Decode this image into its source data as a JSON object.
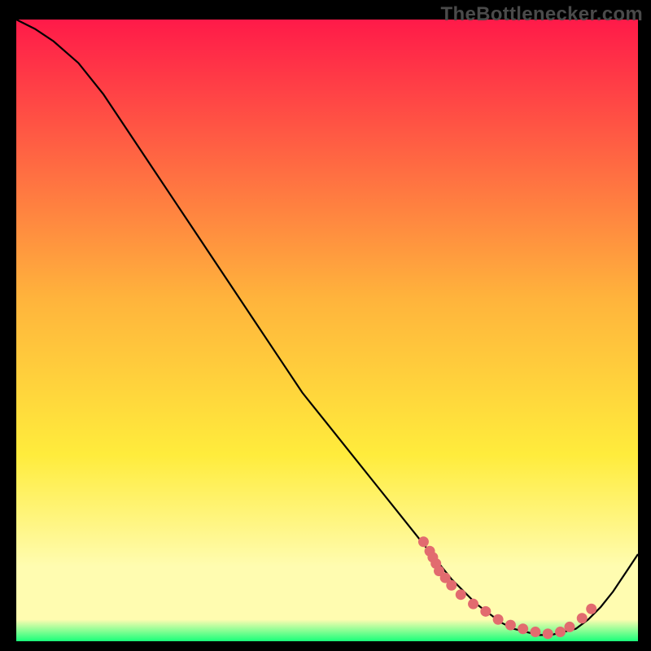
{
  "watermark": "TheBottlenecker.com",
  "colors": {
    "gradient_top": "#ff1a49",
    "gradient_mid_orange": "#ffb43c",
    "gradient_mid_yellow": "#ffec3c",
    "gradient_pale_yellow": "#fffcb0",
    "gradient_green": "#19ff7a",
    "frame": "#000000",
    "curve": "#000000",
    "dot": "#e26b6f"
  },
  "chart_data": {
    "type": "line",
    "title": "",
    "xlabel": "",
    "ylabel": "",
    "xlim": [
      0,
      100
    ],
    "ylim": [
      0,
      100
    ],
    "curve": {
      "x": [
        0,
        3,
        6,
        10,
        14,
        18,
        22,
        26,
        30,
        34,
        38,
        42,
        46,
        50,
        54,
        58,
        62,
        66,
        68,
        70,
        72,
        74,
        76,
        78,
        80,
        82,
        84,
        86,
        88,
        90,
        92,
        94,
        96,
        98,
        100
      ],
      "y": [
        100,
        98.5,
        96.5,
        93,
        88,
        82,
        76,
        70,
        64,
        58,
        52,
        46,
        40,
        35,
        30,
        25,
        20,
        15,
        12.5,
        10,
        8,
        6,
        4.5,
        3,
        2,
        1.5,
        1,
        1,
        1.5,
        2,
        3.5,
        5.5,
        8,
        11,
        14
      ]
    },
    "dots": {
      "x": [
        65.5,
        66.5,
        67,
        67.5,
        68,
        69,
        70,
        71.5,
        73.5,
        75.5,
        77.5,
        79.5,
        81.5,
        83.5,
        85.5,
        87.5,
        89,
        91,
        92.5
      ],
      "y": [
        16,
        14.5,
        13.5,
        12.5,
        11.3,
        10.2,
        9,
        7.5,
        6,
        4.8,
        3.5,
        2.6,
        2,
        1.5,
        1.2,
        1.5,
        2.3,
        3.7,
        5.2
      ]
    }
  }
}
